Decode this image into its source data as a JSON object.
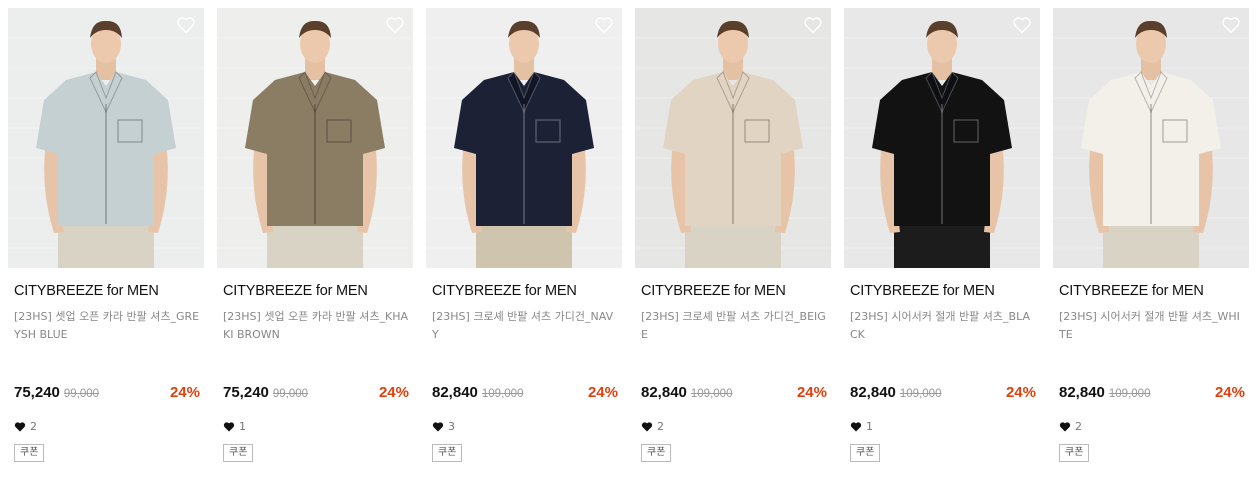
{
  "products": [
    {
      "brand": "CITYBREEZE for MEN",
      "name": "[23HS] 셋업 오픈 카라 반팔 셔츠_GREYSH BLUE",
      "price": "75,240",
      "original_price": "99,000",
      "discount": "24%",
      "likes": "2",
      "coupon": "쿠폰",
      "shirt_color": "#c5d0d3",
      "bg_color": "#eceeee"
    },
    {
      "brand": "CITYBREEZE for MEN",
      "name": "[23HS] 셋업 오픈 카라 반팔 셔츠_KHAKI BROWN",
      "price": "75,240",
      "original_price": "99,000",
      "discount": "24%",
      "likes": "1",
      "coupon": "쿠폰",
      "shirt_color": "#8b7c64",
      "bg_color": "#eeeeec"
    },
    {
      "brand": "CITYBREEZE for MEN",
      "name": "[23HS] 크로셰 반팔 셔츠 가디건_NAVY",
      "price": "82,840",
      "original_price": "109,000",
      "discount": "24%",
      "likes": "3",
      "coupon": "쿠폰",
      "shirt_color": "#1c2135",
      "bg_color": "#efefef"
    },
    {
      "brand": "CITYBREEZE for MEN",
      "name": "[23HS] 크로셰 반팔 셔츠 가디건_BEIGE",
      "price": "82,840",
      "original_price": "109,000",
      "discount": "24%",
      "likes": "2",
      "coupon": "쿠폰",
      "shirt_color": "#e2d4c3",
      "bg_color": "#e6e6e4"
    },
    {
      "brand": "CITYBREEZE for MEN",
      "name": "[23HS] 시어서커 절개 반팔 셔츠_BLACK",
      "price": "82,840",
      "original_price": "109,000",
      "discount": "24%",
      "likes": "1",
      "coupon": "쿠폰",
      "shirt_color": "#121212",
      "bg_color": "#e8e8e8"
    },
    {
      "brand": "CITYBREEZE for MEN",
      "name": "[23HS] 시어서커 절개 반팔 셔츠_WHITE",
      "price": "82,840",
      "original_price": "109,000",
      "discount": "24%",
      "likes": "2",
      "coupon": "쿠폰",
      "shirt_color": "#f3f0ea",
      "bg_color": "#e7e7e7"
    }
  ],
  "icons": {
    "wishlist": "heart-outline-icon",
    "likes": "heart-filled-icon"
  },
  "colors": {
    "discount": "#e0400e",
    "price": "#111111",
    "muted": "#888888"
  }
}
